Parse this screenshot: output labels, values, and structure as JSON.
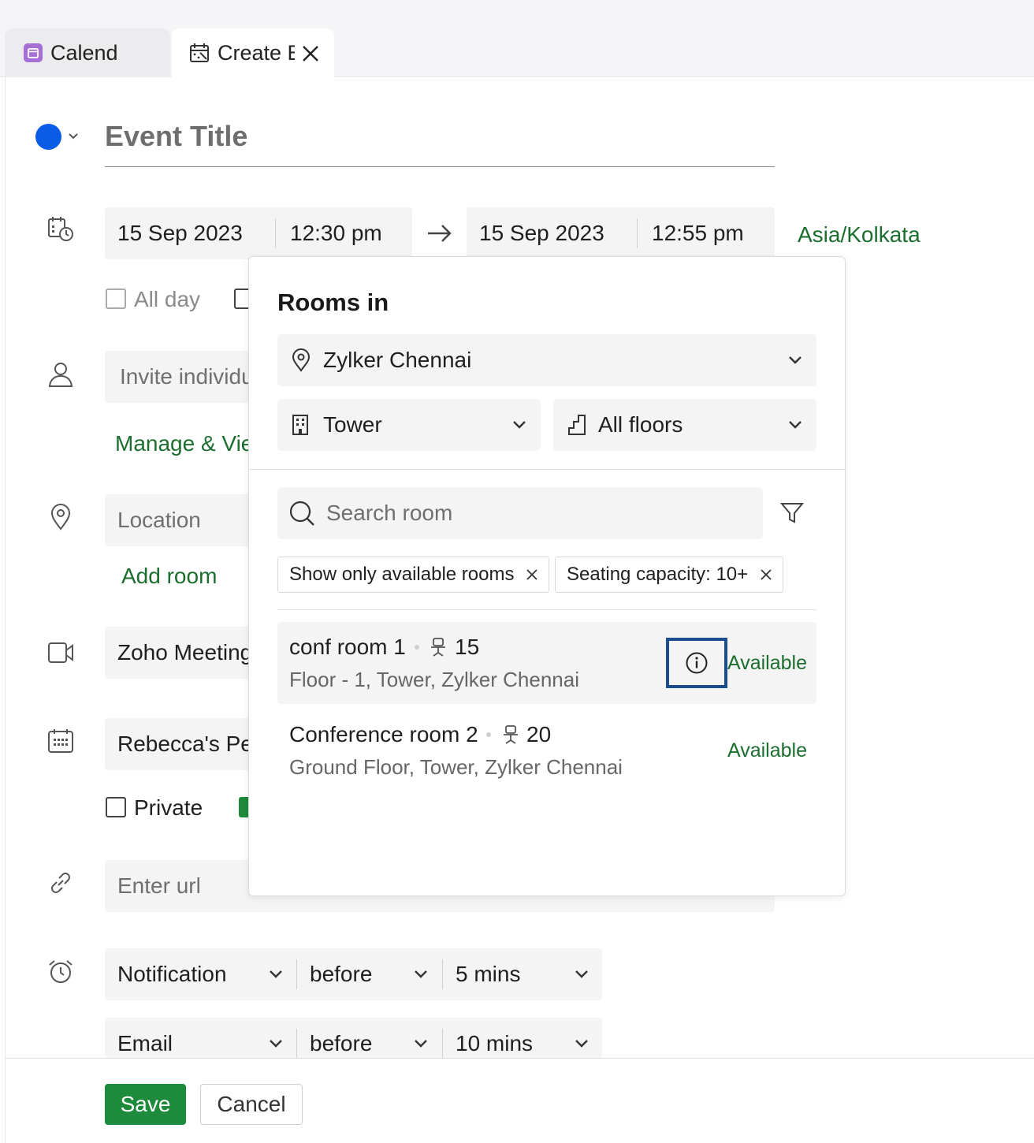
{
  "tabs": [
    {
      "label": "Calend"
    },
    {
      "label": "Create E"
    }
  ],
  "event": {
    "title_placeholder": "Event Title",
    "color": "#0a5ce6",
    "start_date": "15 Sep 2023",
    "start_time": "12:30 pm",
    "end_date": "15 Sep 2023",
    "end_time": "12:55 pm",
    "timezone": "Asia/Kolkata",
    "all_day_label": "All day",
    "invite_placeholder": "Invite individu",
    "manage_link": "Manage & Vie",
    "location_placeholder": "Location",
    "add_room": "Add room",
    "meeting_provider": "Zoho Meeting",
    "calendar": "Rebecca's Per",
    "private_label": "Private",
    "url_placeholder": "Enter url"
  },
  "reminders": [
    {
      "type": "Notification",
      "relation": "before",
      "duration": "5 mins"
    },
    {
      "type": "Email",
      "relation": "before",
      "duration": "10 mins"
    }
  ],
  "rooms_popup": {
    "heading": "Rooms in",
    "location": "Zylker Chennai",
    "building": "Tower",
    "floor": "All floors",
    "search_placeholder": "Search room",
    "chips": [
      "Show only available rooms",
      "Seating capacity: 10+"
    ],
    "rooms": [
      {
        "name": "conf room 1",
        "capacity": "15",
        "place": "Floor - 1, Tower, Zylker Chennai",
        "status": "Available"
      },
      {
        "name": "Conference room 2",
        "capacity": "20",
        "place": "Ground Floor, Tower, Zylker Chennai",
        "status": "Available"
      }
    ]
  },
  "actions": {
    "save": "Save",
    "cancel": "Cancel"
  },
  "colors": {
    "accent_green": "#1e8a3c",
    "link_green": "#1b6e2e",
    "event_color": "#0a5ce6",
    "highlight": "#1a4d8f"
  }
}
